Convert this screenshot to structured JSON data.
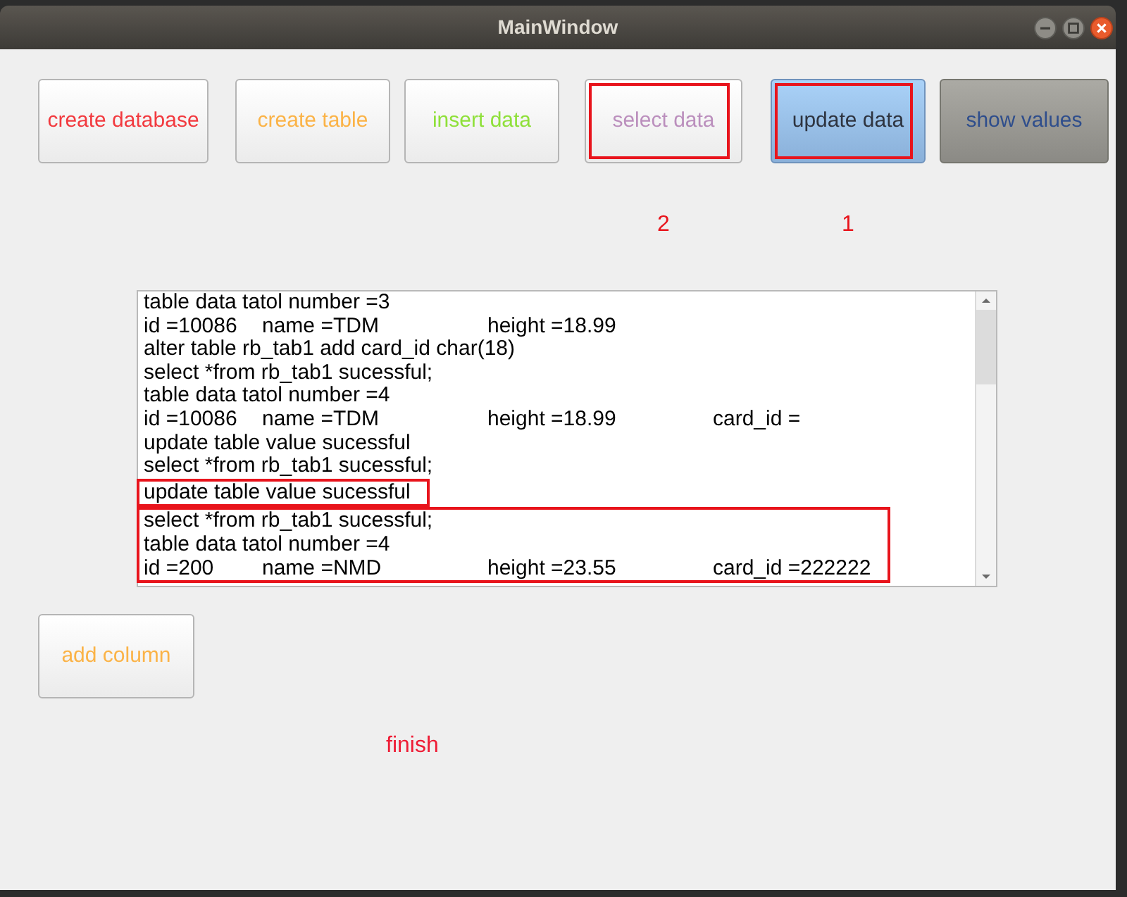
{
  "window": {
    "title": "MainWindow"
  },
  "buttons": [
    {
      "label": "create database",
      "kind": "plain",
      "annotated": false
    },
    {
      "label": "create table",
      "kind": "plain",
      "annotated": false
    },
    {
      "label": "insert data",
      "kind": "plain",
      "annotated": false
    },
    {
      "label": "select data",
      "kind": "plain",
      "annotated": true,
      "note": "2"
    },
    {
      "label": "update data",
      "kind": "pressed",
      "annotated": true,
      "note": "1"
    },
    {
      "label": "show values",
      "kind": "shaded",
      "annotated": false
    }
  ],
  "log": {
    "groups": [
      {
        "boxed": false,
        "lines": [
          [
            "table data tatol number =3"
          ],
          [
            "id =10086",
            "name =TDM",
            "height =18.99"
          ],
          [
            "alter table rb_tab1 add card_id char(18)"
          ],
          [
            "select *from rb_tab1 sucessful;"
          ],
          [
            "table data tatol number =4"
          ],
          [
            "id =10086",
            "name =TDM",
            "height =18.99",
            "card_id ="
          ],
          [
            "update table value sucessful"
          ],
          [
            "select *from rb_tab1 sucessful;"
          ]
        ]
      },
      {
        "boxed": true,
        "lines": [
          [
            "update table value sucessful"
          ]
        ]
      },
      {
        "boxed": true,
        "lines": [
          [
            "select *from rb_tab1 sucessful;"
          ],
          [
            "table data tatol number =4"
          ],
          [
            "id =200",
            "name =NMD",
            "height =23.55",
            "card_id =222222"
          ]
        ]
      }
    ]
  },
  "add_column_button": {
    "label": "add column"
  },
  "finish_label": "finish"
}
